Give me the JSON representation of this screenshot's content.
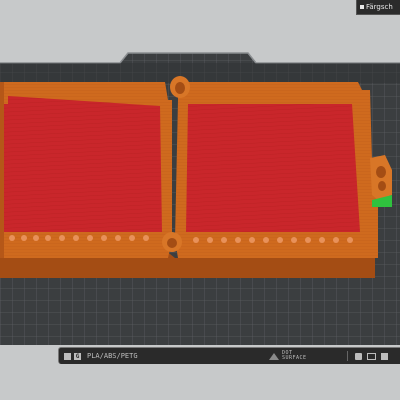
{
  "toolbar": {
    "color_dropdown_label": "Färgsch"
  },
  "status_bar": {
    "material_label": "PLA/ABS/PETG",
    "surface_label_line1": "DOT",
    "surface_label_line2": "SURFACE"
  },
  "colors": {
    "background": "#c7c9ca",
    "build_plate": "#3a3d3f",
    "grid_line": "#5a5e61",
    "model_walls": "#cf6a1e",
    "model_infill": "#c9262b",
    "support_marker": "#2fc23e"
  },
  "icons": [
    "grid-view-icon",
    "g-code-icon",
    "triangle-warning-icon",
    "cylinder-icon",
    "layers-icon",
    "printer-icon"
  ]
}
